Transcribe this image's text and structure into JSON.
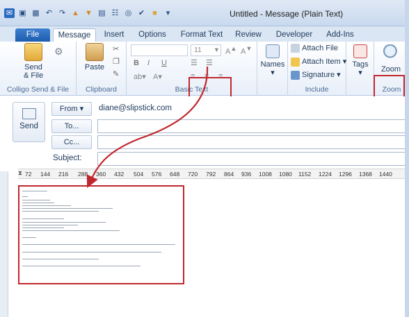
{
  "window": {
    "title": "Untitled  -  Message (Plain Text)"
  },
  "tabs": [
    "File",
    "Message",
    "Insert",
    "Options",
    "Format Text",
    "Review",
    "Developer",
    "Add-Ins"
  ],
  "ribbon": {
    "send_file": {
      "label": "Send\n& File",
      "group": "Colligo Send & File"
    },
    "clipboard": {
      "paste_label": "Paste",
      "group": "Clipboard"
    },
    "basic_text": {
      "font_size": "11",
      "bold": "B",
      "italic": "I",
      "underline": "U",
      "group": "Basic Text"
    },
    "names": {
      "label": "Names"
    },
    "include": {
      "attach_file": "Attach File",
      "attach_item": "Attach Item",
      "signature": "Signature",
      "group": "Include"
    },
    "tags": {
      "label": "Tags"
    },
    "zoom": {
      "label": "Zoom",
      "group": "Zoom"
    }
  },
  "compose": {
    "send_label": "Send",
    "from_label": "From",
    "from_value": "diane@slipstick.com",
    "to_label": "To...",
    "cc_label": "Cc...",
    "subject_label": "Subject:"
  },
  "ruler": [
    "72",
    "144",
    "216",
    "288",
    "360",
    "432",
    "504",
    "576",
    "648",
    "720",
    "792",
    "864",
    "936",
    "1008",
    "1080",
    "1152",
    "1224",
    "1296",
    "1368",
    "1440"
  ],
  "colors": {
    "annotation": "#c0262d",
    "accent": "#1e5dae"
  }
}
